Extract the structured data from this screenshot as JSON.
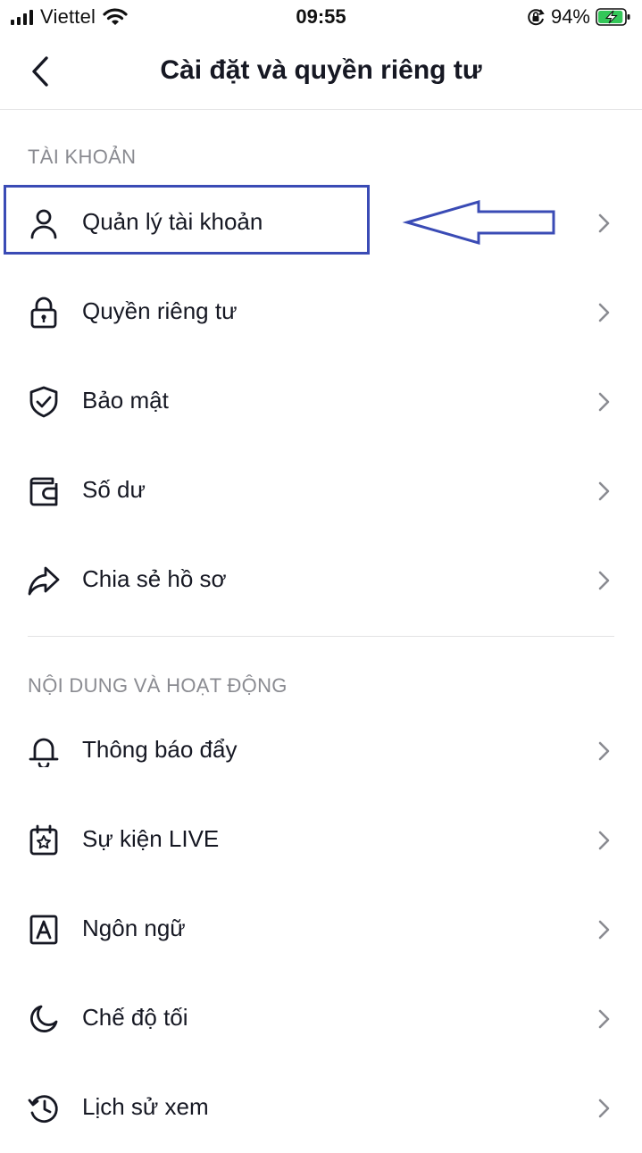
{
  "status_bar": {
    "carrier": "Viettel",
    "time": "09:55",
    "battery_percent": "94%",
    "battery_level": 0.94,
    "icons": [
      "signal-icon",
      "wifi-icon",
      "orientation-lock-icon",
      "battery-charging-icon"
    ]
  },
  "header": {
    "title": "Cài đặt và quyền riêng tư",
    "back_icon": "chevron-left-icon"
  },
  "sections": [
    {
      "label": "TÀI KHOẢN",
      "items": [
        {
          "label": "Quản lý tài khoản",
          "icon": "person-icon"
        },
        {
          "label": "Quyền riêng tư",
          "icon": "lock-icon"
        },
        {
          "label": "Bảo mật",
          "icon": "shield-check-icon"
        },
        {
          "label": "Số dư",
          "icon": "wallet-icon"
        },
        {
          "label": "Chia sẻ hồ sơ",
          "icon": "share-icon"
        }
      ]
    },
    {
      "label": "NỘI DUNG VÀ HOẠT ĐỘNG",
      "items": [
        {
          "label": "Thông báo đẩy",
          "icon": "bell-icon"
        },
        {
          "label": "Sự kiện LIVE",
          "icon": "calendar-star-icon"
        },
        {
          "label": "Ngôn ngữ",
          "icon": "language-icon"
        },
        {
          "label": "Chế độ tối",
          "icon": "moon-icon"
        },
        {
          "label": "Lịch sử xem",
          "icon": "history-icon"
        }
      ]
    }
  ],
  "annotation": {
    "highlight_color": "#3a4bb5",
    "highlighted_item": "Quản lý tài khoản"
  },
  "colors": {
    "text": "#161823",
    "section_label": "#8a8b91",
    "chevron": "#8a8b91",
    "divider": "#e3e3e4",
    "battery_fill": "#34c759"
  }
}
